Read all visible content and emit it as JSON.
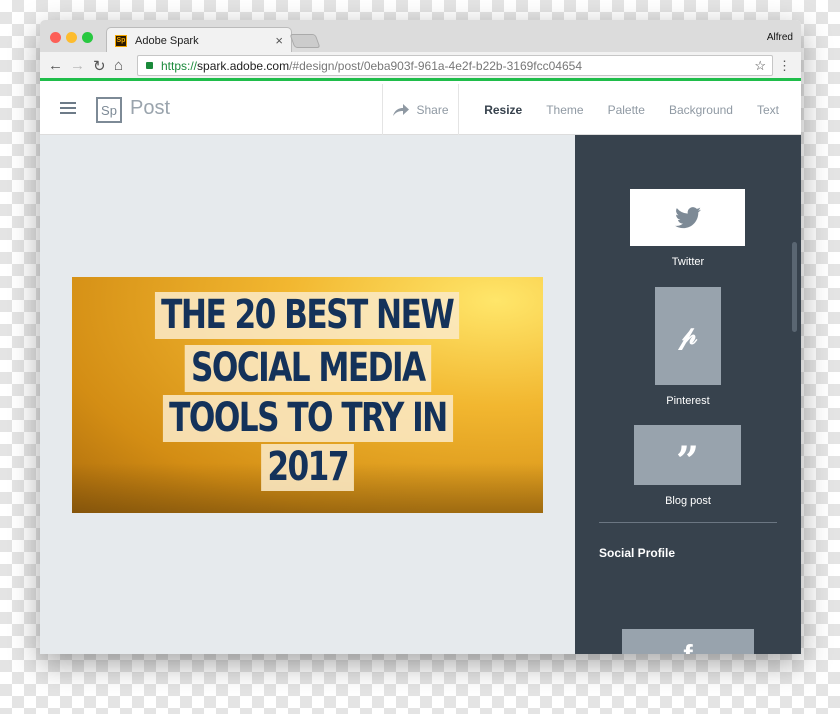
{
  "browser": {
    "tab_title": "Adobe Spark",
    "favicon": "Sp",
    "user": "Alfred",
    "url": {
      "scheme": "https://",
      "host": "spark.adobe.com",
      "path": "/#design/post/0eba903f-961a-4e2f-b22b-3169fcc04654"
    }
  },
  "header": {
    "logo": "Sp",
    "title": "Post",
    "share": "Share",
    "menu": [
      {
        "label": "Resize",
        "active": true
      },
      {
        "label": "Theme"
      },
      {
        "label": "Palette"
      },
      {
        "label": "Background"
      },
      {
        "label": "Text"
      }
    ]
  },
  "post": {
    "lines": [
      "THE 20 BEST NEW",
      "SOCIAL MEDIA",
      "TOOLS TO TRY IN",
      "2017"
    ]
  },
  "panel": {
    "sizes": [
      {
        "label": "Twitter",
        "icon": "twitter-icon"
      },
      {
        "label": "Pinterest",
        "icon": "pinterest-icon"
      },
      {
        "label": "Blog post",
        "icon": "quote-icon"
      }
    ],
    "section": "Social Profile",
    "social": [
      {
        "icon": "facebook-icon"
      }
    ]
  },
  "colors": {
    "accent_green": "#1fbd4a",
    "panel": "#37424d",
    "canvas": "#e6eaed",
    "headline": "#14325a"
  }
}
